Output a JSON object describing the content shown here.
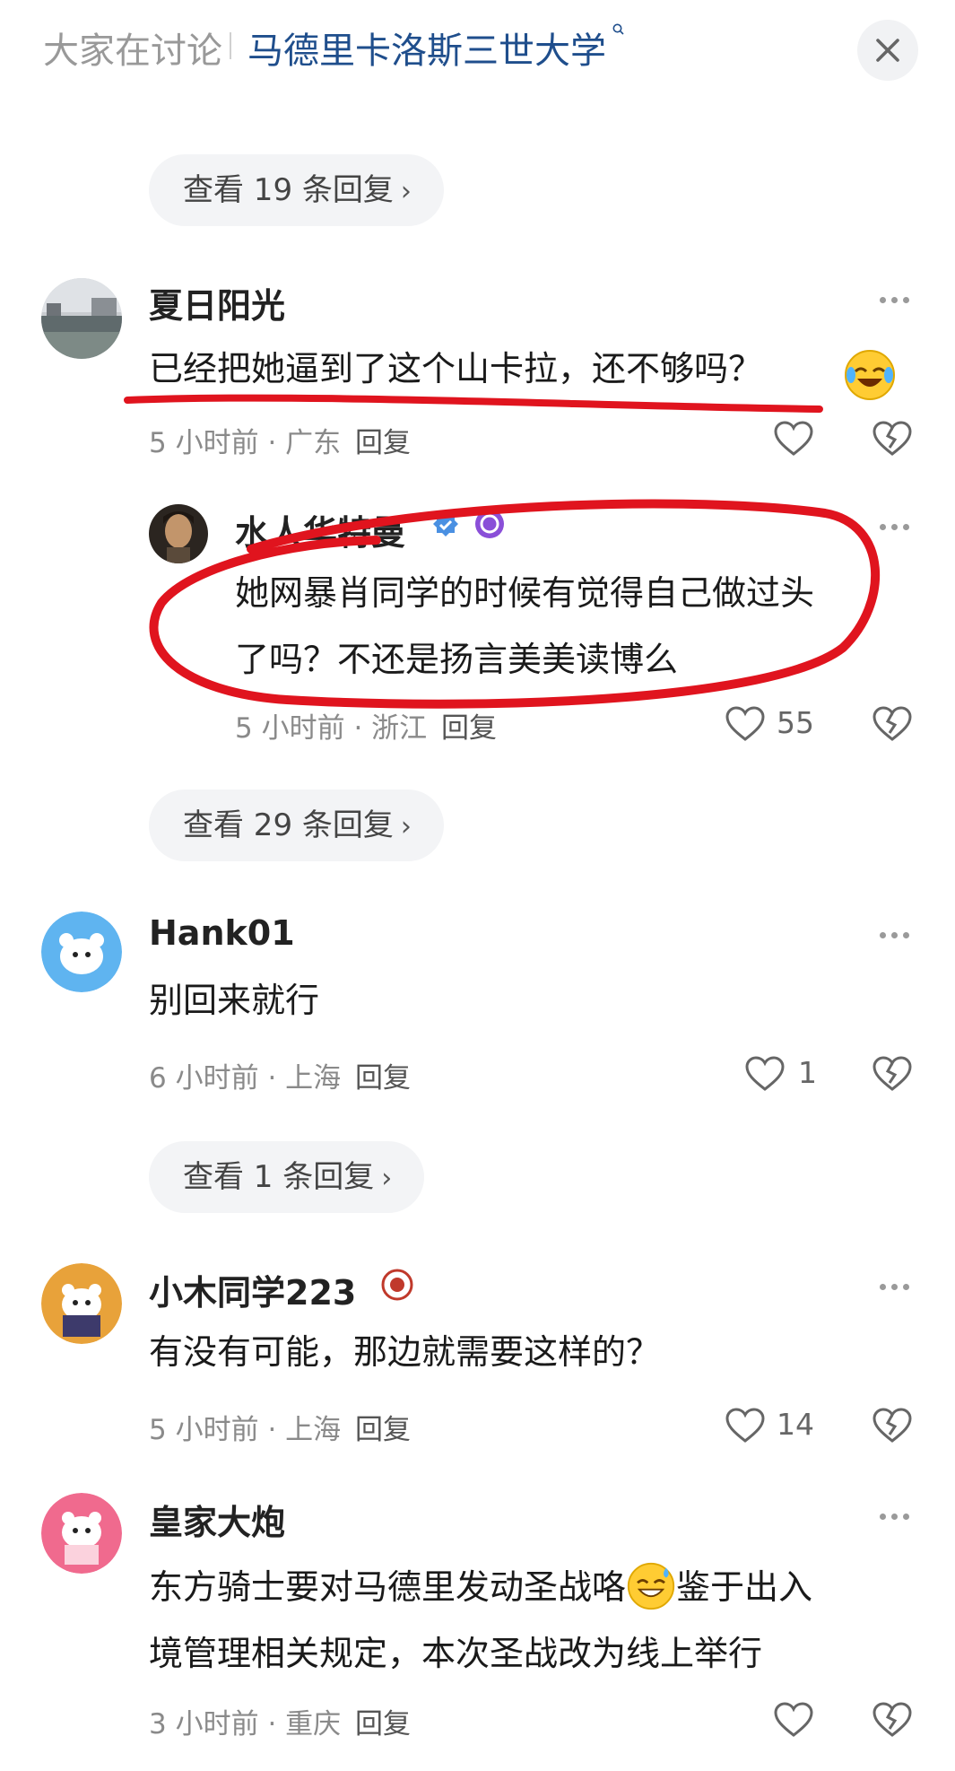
{
  "header": {
    "lead": "大家在讨论",
    "topic": "马德里卡洛斯三世大学"
  },
  "pills": [
    "查看 19 条回复",
    "查看 29 条回复",
    "查看 1 条回复"
  ],
  "comments": [
    {
      "name": "夏日阳光",
      "text": "已经把她逼到了这个山卡拉，还不够吗？",
      "time": "5 小时前",
      "location": "广东",
      "reply_label": "回复",
      "likes": ""
    },
    {
      "name": "水人华特曼",
      "lines": [
        "她网暴肖同学的时候有觉得自己做过头",
        "了吗？不还是扬言美美读博么"
      ],
      "time": "5 小时前",
      "location": "浙江",
      "reply_label": "回复",
      "likes": "55"
    },
    {
      "name": "Hank01",
      "text": "别回来就行",
      "time": "6 小时前",
      "location": "上海",
      "reply_label": "回复",
      "likes": "1"
    },
    {
      "name": "小木同学223",
      "text": "有没有可能，那边就需要这样的？",
      "time": "5 小时前",
      "location": "上海",
      "reply_label": "回复",
      "likes": "14"
    },
    {
      "name": "皇家大炮",
      "line1": "东方骑士要对马德里发动圣战咯",
      "line1b": "鉴于出入",
      "line2": "境管理相关规定，本次圣战改为线上举行",
      "time": "3 小时前",
      "location": "重庆",
      "reply_label": "回复",
      "likes": ""
    }
  ],
  "separator": "·",
  "colors": {
    "annotation": "#e0141e",
    "topic": "#1f4e8c"
  }
}
